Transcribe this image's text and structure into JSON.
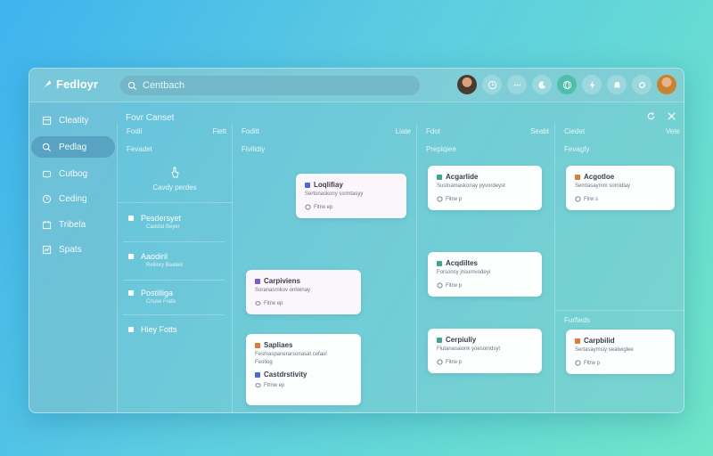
{
  "app": {
    "title": "Fedloyr"
  },
  "search": {
    "placeholder": "Centbach"
  },
  "sidebar": {
    "items": [
      {
        "label": "Cleatity",
        "icon": "grid-icon"
      },
      {
        "label": "Pedlag",
        "icon": "search-icon"
      },
      {
        "label": "Cutbog",
        "icon": "box-icon"
      },
      {
        "label": "Ceding",
        "icon": "clock-icon"
      },
      {
        "label": "Tribela",
        "icon": "calendar-icon"
      },
      {
        "label": "Spats",
        "icon": "chart-icon"
      }
    ]
  },
  "main": {
    "title": "Fovr Canset",
    "columns": [
      {
        "left": "Fodil",
        "right": "Fiett",
        "sub": "Fevadet"
      },
      {
        "left": "Foditt",
        "right": "Liate",
        "sub": "Fivilidiy"
      },
      {
        "left": "Fdot",
        "right": "Seabt",
        "sub": "Prepiqiee"
      },
      {
        "left": "Ciedet",
        "right": "Vete",
        "sub": "Fevagfy"
      }
    ],
    "col1_empty": "Cavdy perdes",
    "col1_list": [
      {
        "title": "Pesdersyet",
        "sub": "Cadslat Beyer"
      },
      {
        "title": "Aaodiril",
        "sub": "Rellinry Beated"
      },
      {
        "title": "Postilliga",
        "sub": "Cnuse Frate"
      },
      {
        "title": "Hiey Fotts",
        "sub": ""
      }
    ],
    "col4_sub2": "Furfieds"
  },
  "cards": {
    "c1": {
      "title": "Loqlifiay",
      "text": "Sertonaskony ssrmtasyy",
      "meta": "Fitrw ep"
    },
    "c2": {
      "title": "Carpiviens",
      "text": "Soranasrnkov onlwinay",
      "meta": "Fitrw ep"
    },
    "c3": {
      "title": "Sapliaes",
      "text": "Fesmaspanerarsonasat cefaul",
      "text2": "Feollog",
      "meta": "Ftrnw ep"
    },
    "c3b": {
      "title": "Castdrstivity"
    },
    "c4": {
      "title": "Acgarlide",
      "text": "Sustnamaskonay pyvordeyst",
      "meta": "Fitrw p"
    },
    "c5": {
      "title": "Acqdiltes",
      "text": "Forsonsy jnsurnvodeyi",
      "meta": "Fitrw p"
    },
    "c6": {
      "title": "Cerpiuliy",
      "text": "Flutanasaionk yoesomdsyt",
      "meta": "Fitrw p"
    },
    "c7": {
      "title": "Acgotloe",
      "text": "Semtasaymm somidlay",
      "meta": "Flrw s"
    },
    "c8": {
      "title": "Carpbilid",
      "text": "Sertasaymsiy sealwiglee",
      "meta": "Fltrw p"
    }
  },
  "colors": {
    "accent": "#4fbfa9",
    "badge_blue": "#4a6ad8",
    "badge_green": "#3ea68a",
    "badge_orange": "#e07a3a"
  }
}
